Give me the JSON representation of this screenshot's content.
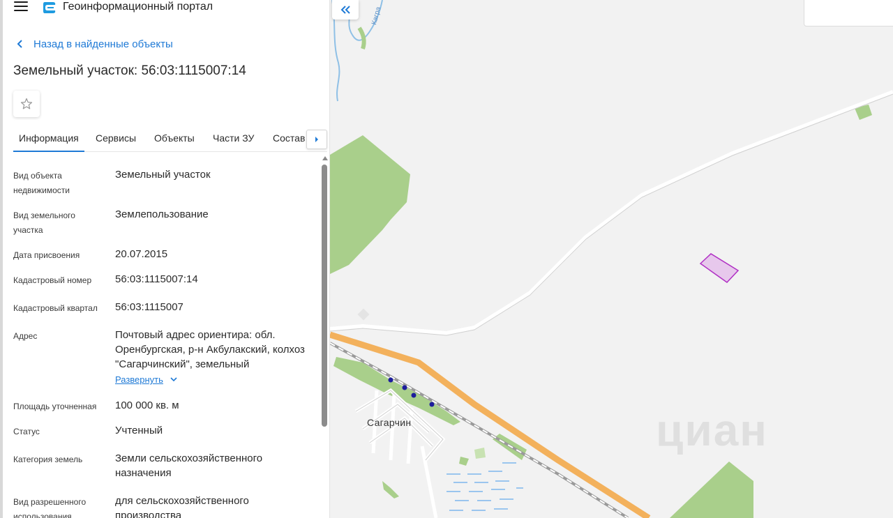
{
  "header": {
    "portal_title": "Геоинформационный портал"
  },
  "nav": {
    "back_label": "Назад в найденные объекты"
  },
  "object": {
    "title": "Земельный участок: 56:03:1115007:14"
  },
  "tabs": [
    {
      "label": "Информация",
      "active": true
    },
    {
      "label": "Сервисы"
    },
    {
      "label": "Объекты"
    },
    {
      "label": "Части ЗУ"
    },
    {
      "label": "Состав"
    }
  ],
  "info_rows": [
    {
      "label": "Вид объекта недвижимости",
      "value": "Земельный участок"
    },
    {
      "label": "Вид земельного участка",
      "value": "Землепользование"
    },
    {
      "label": "Дата присвоения",
      "value": "20.07.2015"
    },
    {
      "label": "Кадастровый номер",
      "value": "56:03:1115007:14"
    },
    {
      "label": "Кадастровый квартал",
      "value": "56:03:1115007"
    },
    {
      "label": "Адрес",
      "value": "Почтовый адрес ориентира: обл. Оренбургская, р-н Акбулакский, колхоз \"Сагарчинский\", земельный"
    },
    {
      "label": "Площадь уточненная",
      "value": "100 000 кв. м"
    },
    {
      "label": "Статус",
      "value": "Учтенный"
    },
    {
      "label": "Категория земель",
      "value": "Земли сельскохозяйственного назначения"
    },
    {
      "label": "Вид разрешенного использования",
      "value": "для сельскохозяйственного производства"
    }
  ],
  "expand_label": "Развернуть",
  "map": {
    "town_label": "Сагарчин",
    "river_label": "Кагра",
    "watermark": "циан",
    "parcel_color": "#b02fc4",
    "road_color": "#f3b15c",
    "forest_color": "#a9cf8b"
  },
  "colors": {
    "accent": "#1f7ad6"
  }
}
